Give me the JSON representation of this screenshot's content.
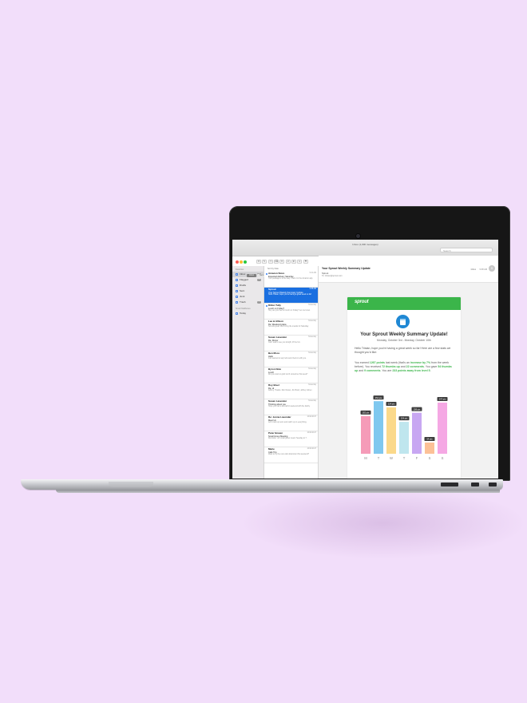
{
  "window": {
    "title": "Inbox (1,000 messages)",
    "search_placeholder": "Search"
  },
  "sidebar": {
    "section_favorites": "Favorites",
    "items": [
      {
        "label": "Inbox",
        "count": "3"
      },
      {
        "label": "Flagged",
        "count": "4"
      },
      {
        "label": "Drafts",
        "count": ""
      },
      {
        "label": "Sent",
        "count": ""
      },
      {
        "label": "Junk",
        "count": ""
      },
      {
        "label": "Trash",
        "count": "1"
      }
    ],
    "section_smart": "Smart Mailboxes",
    "smart_items": [
      {
        "label": "Today"
      }
    ]
  },
  "tabs": [
    "Inbox",
    "Sent",
    "Flagged",
    "Drafts"
  ],
  "list": {
    "sort_label": "Sort by Date",
    "messages": [
      {
        "from": "Amazon Store",
        "date": "9:41 AM",
        "subject": "Expected delivery Saturday",
        "preview": "Your package is on its way. Track it in the Amazon app."
      },
      {
        "from": "Sprout",
        "date": "9:38 AM",
        "subject": "Your Sprout Weekly Summary Update",
        "preview": "Hello Tristan, hope you're having a great week so far!",
        "selected": true
      },
      {
        "from": "Dillon Tully",
        "date": "Yesterday",
        "subject": "Lunch on Friday?",
        "preview": "Hey, are you free for lunch on Friday? Let me know."
      },
      {
        "from": "Lee & Allison",
        "date": "Yesterday",
        "subject": "Re: Weekend plans",
        "preview": "Sounds great! We'll bring the snacks for Saturday."
      },
      {
        "from": "Susan Lavender",
        "date": "Yesterday",
        "subject": "Re: Dinner",
        "preview": "Can't wait to see you tonight, it'll be fun."
      },
      {
        "from": "Ben Moss",
        "date": "Yesterday",
        "subject": "Hello",
        "preview": "Just wanted to say hello and check in with you."
      },
      {
        "from": "Byron Nole",
        "date": "Yesterday",
        "subject": "Lunch",
        "preview": "Did you want to grab lunch sometime this week?"
      },
      {
        "from": "Roy Bisel",
        "date": "Yesterday",
        "subject": "Re: Hi",
        "preview": "Jeffrey, Thanks. Ron Russo, Jim Bond, Jeffrey Cohen"
      },
      {
        "from": "Susan Lavender",
        "date": "Yesterday",
        "subject": "Thinking about you",
        "preview": "Hope you had a wonderful weekend with the family."
      },
      {
        "from": "Re: Jenna Lavender",
        "date": "10/21/2017",
        "subject": "Meet Up",
        "preview": "Let's meet up soon and catch up on everything."
      },
      {
        "from": "Peter Bowen",
        "date": "10/21/2017",
        "subject": "Small Group Meeting",
        "preview": "Reminder: our small group meets Tuesday at 7."
      },
      {
        "from": "Marie",
        "date": "10/21/2017",
        "subject": "Café Trip",
        "preview": "Want to try the new café downtown this weekend?"
      }
    ]
  },
  "reader": {
    "subject": "Your Sprout Weekly Summary Update",
    "from": "Sprout",
    "to": "To: tristan@sprout.com",
    "mailbox": "Inbox",
    "time": "9:38 AM",
    "avatar_initial": "S"
  },
  "email": {
    "brand": "sprout",
    "title": "Your Sprout Weekly Summary Update!",
    "subtitle": "Monday, October 3rd - Monday, October 10th",
    "intro": "Hello Tristan, hope you're having a great week so far! Here are a few stats we thought you'd like:",
    "stats_text_1": "You earned ",
    "points": "1267 points",
    "stats_text_2": " last week (that's an ",
    "increase": "increase by 7%",
    "stats_text_3": " from the week before). You received ",
    "thumbs_up": "72 thumbs up",
    "stats_text_4": " and ",
    "comments": "22 comments",
    "stats_text_5": ". You gave ",
    "given_thumbs": "54 thumbs up",
    "stats_text_6": " and ",
    "given_comments": "9 comments",
    "stats_text_7": ". You are ",
    "away": "233 points away from level 5",
    "stats_text_8": "."
  },
  "colors": {
    "brand_green": "#3bb54a",
    "badge_blue": "#1f88d4",
    "selected_blue": "#1a6fe0"
  },
  "chart_data": {
    "type": "bar",
    "categories": [
      "M",
      "T",
      "W",
      "T",
      "F",
      "S",
      "S"
    ],
    "values": [
      182,
      254,
      224,
      154,
      198,
      54,
      247
    ],
    "labels": [
      "182 pts",
      "254 pts",
      "224 pts",
      "154 pts",
      "198 pts",
      "54 pts",
      "247 pts"
    ],
    "colors": [
      "#f59bb8",
      "#7fc8ef",
      "#fbd98a",
      "#bfe6ee",
      "#c8a7f2",
      "#fcc197",
      "#f5a8e4"
    ],
    "ylim": [
      0,
      300
    ]
  }
}
